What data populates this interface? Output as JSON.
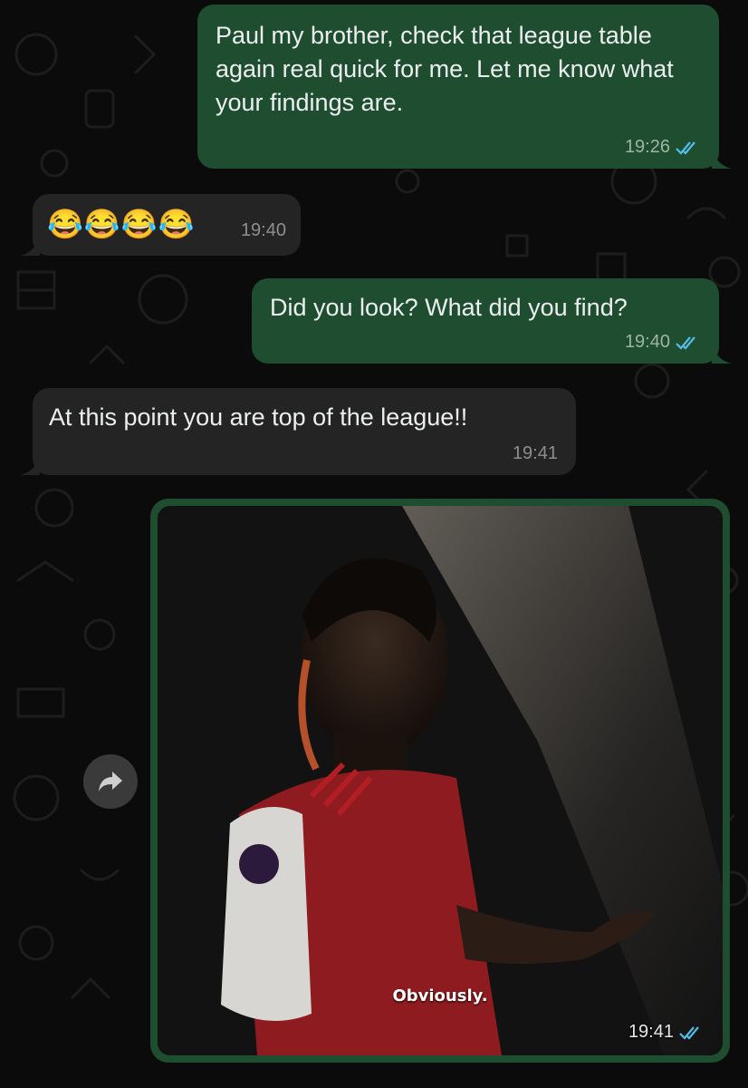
{
  "chat": {
    "messages": [
      {
        "direction": "out",
        "text": "Paul my brother, check that league table again real quick for me. Let me know what your findings are.",
        "time": "19:26",
        "status": "read"
      },
      {
        "direction": "in",
        "text": "😂😂😂😂",
        "time": "19:40"
      },
      {
        "direction": "out",
        "text": "Did you look? What did you find?",
        "time": "19:40",
        "status": "read"
      },
      {
        "direction": "in",
        "text": "At this point you are top of the league!!",
        "time": "19:41"
      },
      {
        "direction": "out",
        "type": "media",
        "caption": "Obviously.",
        "time": "19:41",
        "status": "read"
      }
    ],
    "forward_icon": "forward-arrow-icon",
    "colors": {
      "outgoing_bubble": "#1f4d2f",
      "incoming_bubble": "#242424",
      "read_ticks": "#53bdeb",
      "background": "#0b0b0b"
    }
  }
}
